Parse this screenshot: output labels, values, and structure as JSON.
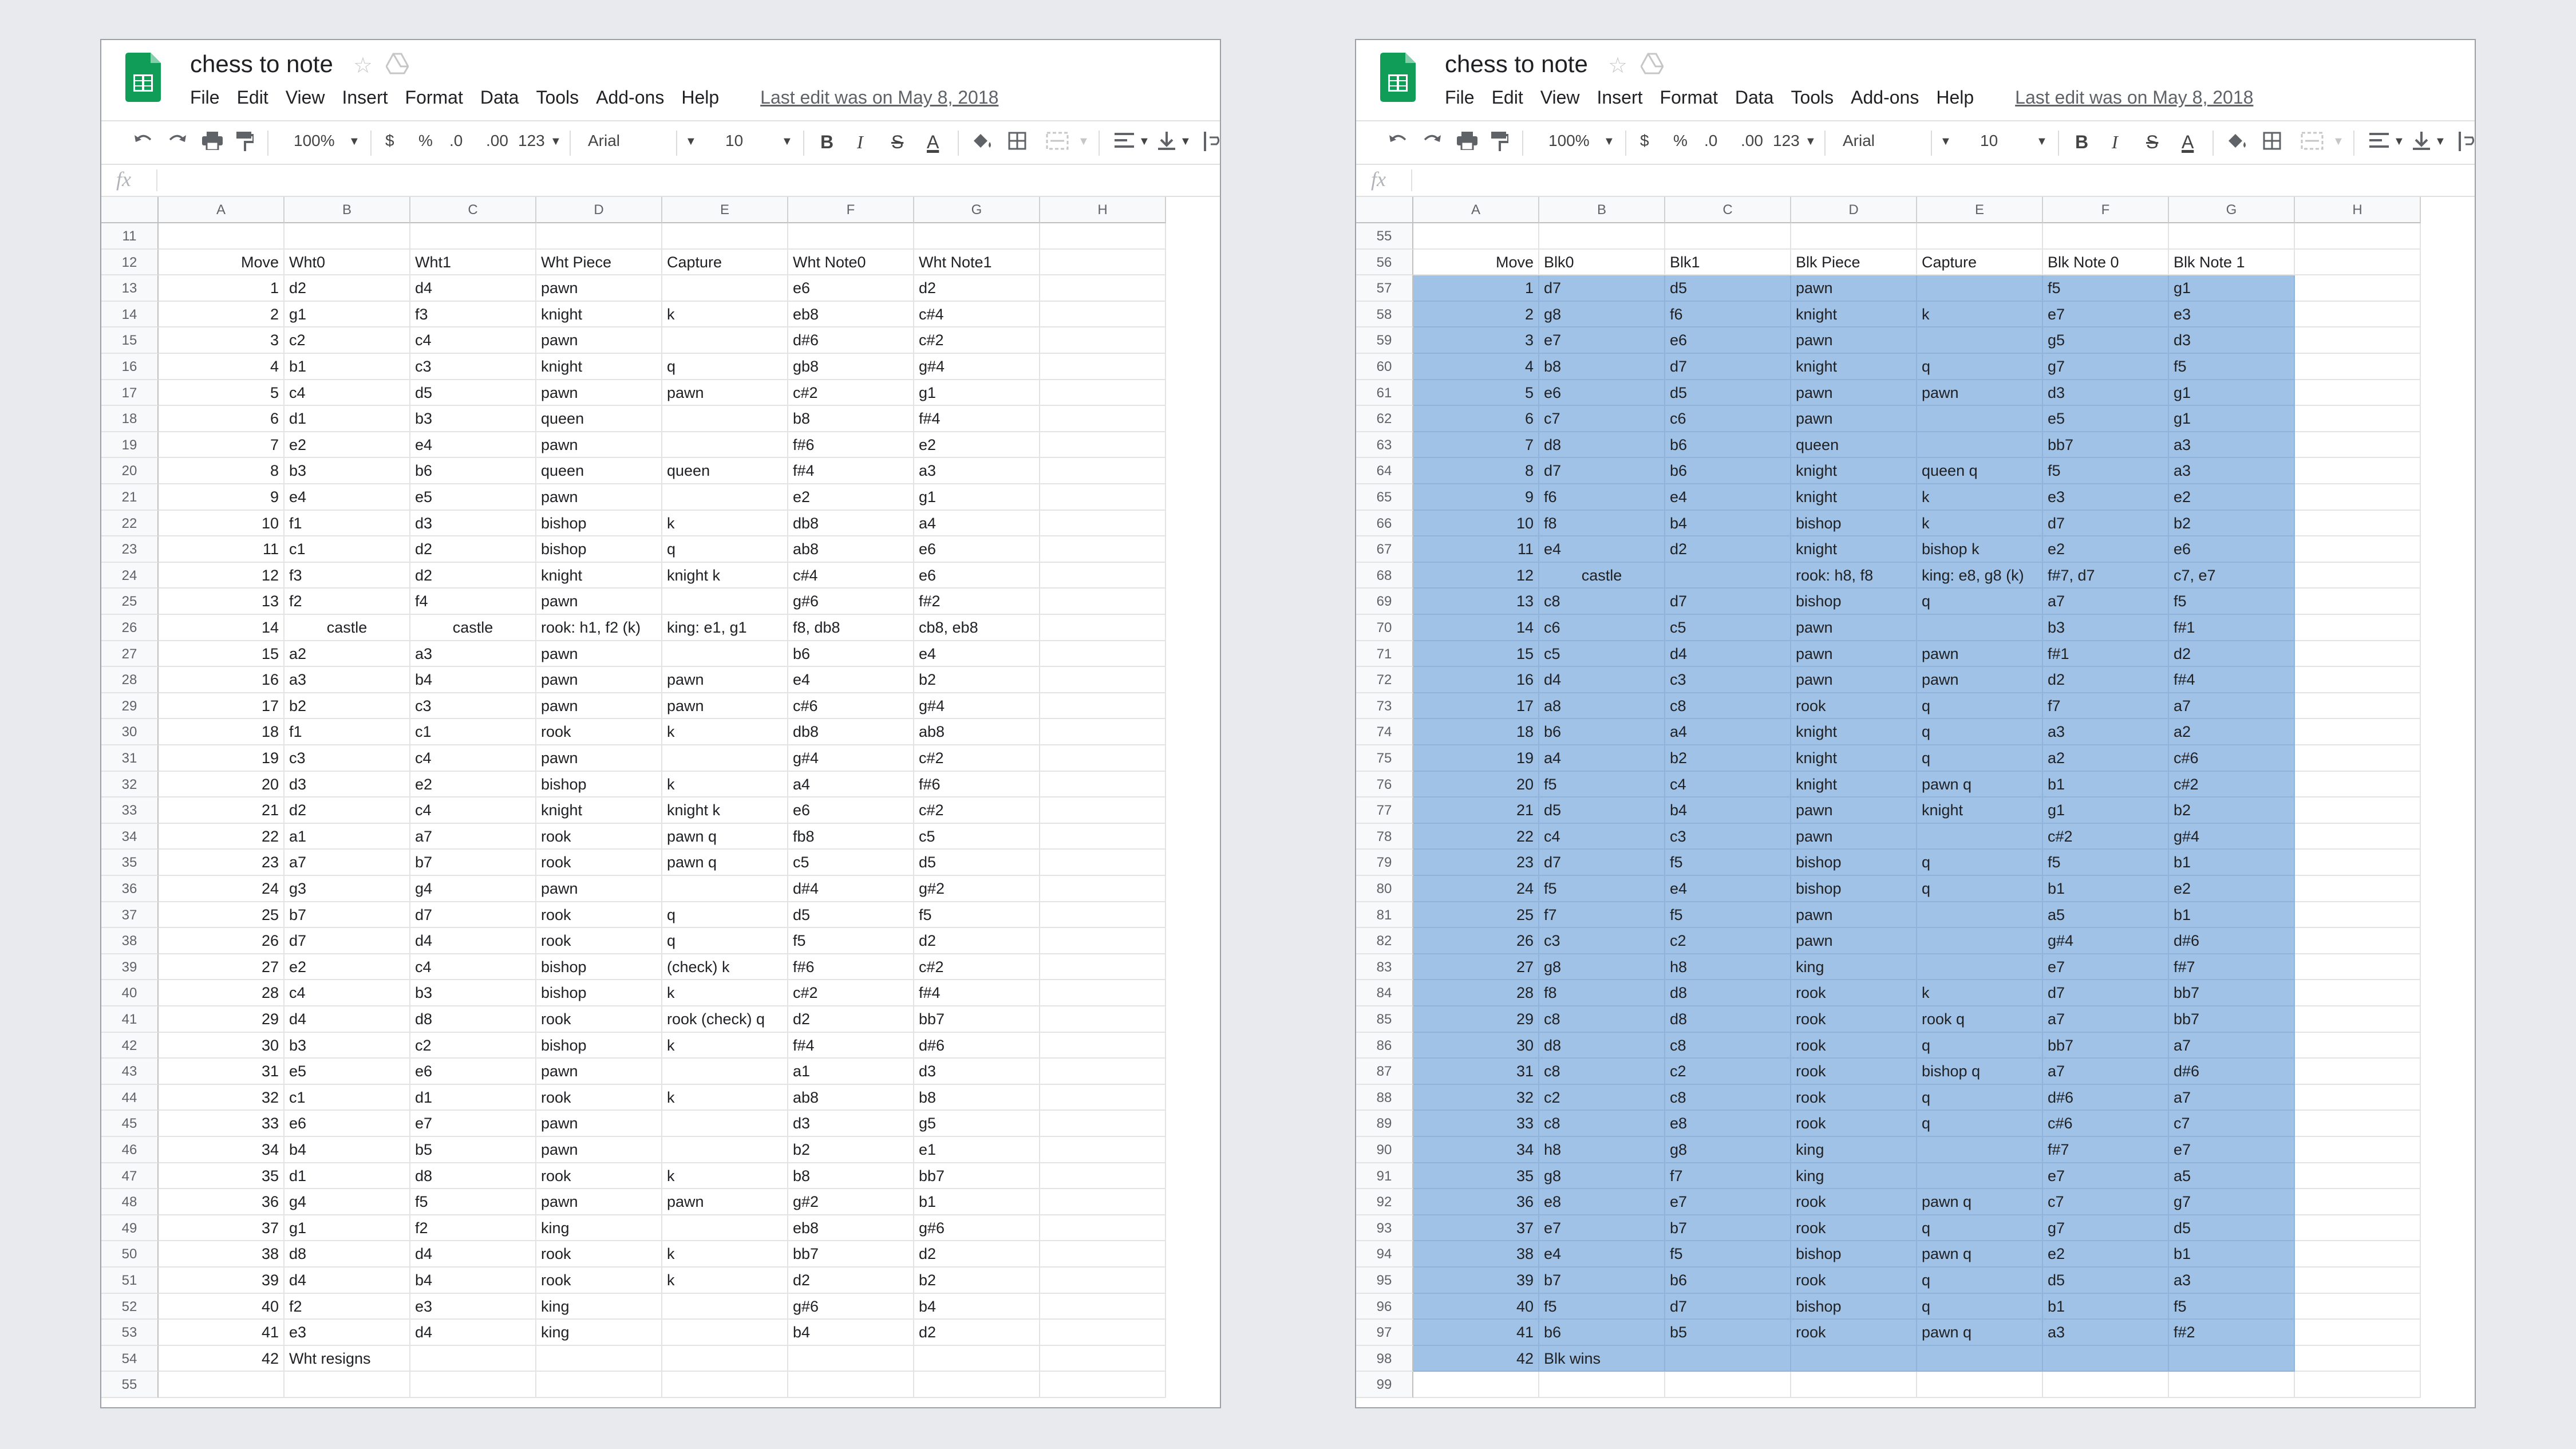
{
  "sheets": [
    {
      "title": "chess to note",
      "menu": [
        "File",
        "Edit",
        "View",
        "Insert",
        "Format",
        "Data",
        "Tools",
        "Add-ons",
        "Help"
      ],
      "last_edit": "Last edit was on May 8, 2018",
      "toolbar": {
        "zoom": "100%",
        "currency": "$",
        "percent": "%",
        "dec_less": ".0",
        "dec_more": ".00",
        "format_more": "123",
        "font": "Arial",
        "font_size": "10",
        "bold": "B",
        "italic": "I",
        "strike": "S",
        "text_color": "A"
      },
      "fx": "fx",
      "columns": [
        "A",
        "B",
        "C",
        "D",
        "E",
        "F",
        "G",
        "H"
      ],
      "selection_start": 0,
      "selection_end": 0,
      "rows": [
        {
          "n": "11",
          "c": [
            "",
            "",
            "",
            "",
            "",
            "",
            ""
          ]
        },
        {
          "n": "12",
          "c": [
            "Move",
            "Wht0",
            "Wht1",
            "Wht Piece",
            "Capture",
            "Wht Note0",
            "Wht Note1"
          ]
        },
        {
          "n": "13",
          "c": [
            "1",
            "d2",
            "d4",
            "pawn",
            "",
            "e6",
            "d2"
          ]
        },
        {
          "n": "14",
          "c": [
            "2",
            "g1",
            "f3",
            "knight",
            "k",
            "eb8",
            "c#4"
          ]
        },
        {
          "n": "15",
          "c": [
            "3",
            "c2",
            "c4",
            "pawn",
            "",
            "d#6",
            "c#2"
          ]
        },
        {
          "n": "16",
          "c": [
            "4",
            "b1",
            "c3",
            "knight",
            "q",
            "gb8",
            "g#4"
          ]
        },
        {
          "n": "17",
          "c": [
            "5",
            "c4",
            "d5",
            "pawn",
            "pawn",
            "c#2",
            "g1"
          ]
        },
        {
          "n": "18",
          "c": [
            "6",
            "d1",
            "b3",
            "queen",
            "",
            "b8",
            "f#4"
          ]
        },
        {
          "n": "19",
          "c": [
            "7",
            "e2",
            "e4",
            "pawn",
            "",
            "f#6",
            "e2"
          ]
        },
        {
          "n": "20",
          "c": [
            "8",
            "b3",
            "b6",
            "queen",
            "queen",
            "f#4",
            "a3"
          ]
        },
        {
          "n": "21",
          "c": [
            "9",
            "e4",
            "e5",
            "pawn",
            "",
            "e2",
            "g1"
          ]
        },
        {
          "n": "22",
          "c": [
            "10",
            "f1",
            "d3",
            "bishop",
            "k",
            "db8",
            "a4"
          ]
        },
        {
          "n": "23",
          "c": [
            "11",
            "c1",
            "d2",
            "bishop",
            "q",
            "ab8",
            "e6"
          ]
        },
        {
          "n": "24",
          "c": [
            "12",
            "f3",
            "d2",
            "knight",
            "knight k",
            "c#4",
            "e6"
          ]
        },
        {
          "n": "25",
          "c": [
            "13",
            "f2",
            "f4",
            "pawn",
            "",
            "g#6",
            "f#2"
          ]
        },
        {
          "n": "26",
          "c": [
            "14",
            "castle",
            "castle",
            "rook: h1, f2 (k)",
            "king: e1, g1",
            "f8, db8",
            "cb8, eb8"
          ],
          "castle": true
        },
        {
          "n": "27",
          "c": [
            "15",
            "a2",
            "a3",
            "pawn",
            "",
            "b6",
            "e4"
          ]
        },
        {
          "n": "28",
          "c": [
            "16",
            "a3",
            "b4",
            "pawn",
            "pawn",
            "e4",
            "b2"
          ]
        },
        {
          "n": "29",
          "c": [
            "17",
            "b2",
            "c3",
            "pawn",
            "pawn",
            "c#6",
            "g#4"
          ]
        },
        {
          "n": "30",
          "c": [
            "18",
            "f1",
            "c1",
            "rook",
            "k",
            "db8",
            "ab8"
          ]
        },
        {
          "n": "31",
          "c": [
            "19",
            "c3",
            "c4",
            "pawn",
            "",
            "g#4",
            "c#2"
          ]
        },
        {
          "n": "32",
          "c": [
            "20",
            "d3",
            "e2",
            "bishop",
            "k",
            "a4",
            "f#6"
          ]
        },
        {
          "n": "33",
          "c": [
            "21",
            "d2",
            "c4",
            "knight",
            "knight k",
            "e6",
            "c#2"
          ]
        },
        {
          "n": "34",
          "c": [
            "22",
            "a1",
            "a7",
            "rook",
            "pawn q",
            "fb8",
            "c5"
          ]
        },
        {
          "n": "35",
          "c": [
            "23",
            "a7",
            "b7",
            "rook",
            "pawn q",
            "c5",
            "d5"
          ]
        },
        {
          "n": "36",
          "c": [
            "24",
            "g3",
            "g4",
            "pawn",
            "",
            "d#4",
            "g#2"
          ]
        },
        {
          "n": "37",
          "c": [
            "25",
            "b7",
            "d7",
            "rook",
            "q",
            "d5",
            "f5"
          ]
        },
        {
          "n": "38",
          "c": [
            "26",
            "d7",
            "d4",
            "rook",
            "q",
            "f5",
            "d2"
          ]
        },
        {
          "n": "39",
          "c": [
            "27",
            "e2",
            "c4",
            "bishop",
            "(check) k",
            "f#6",
            "c#2"
          ]
        },
        {
          "n": "40",
          "c": [
            "28",
            "c4",
            "b3",
            "bishop",
            "k",
            "c#2",
            "f#4"
          ]
        },
        {
          "n": "41",
          "c": [
            "29",
            "d4",
            "d8",
            "rook",
            "rook (check) q",
            "d2",
            "bb7"
          ]
        },
        {
          "n": "42",
          "c": [
            "30",
            "b3",
            "c2",
            "bishop",
            "k",
            "f#4",
            "d#6"
          ]
        },
        {
          "n": "43",
          "c": [
            "31",
            "e5",
            "e6",
            "pawn",
            "",
            "a1",
            "d3"
          ]
        },
        {
          "n": "44",
          "c": [
            "32",
            "c1",
            "d1",
            "rook",
            "k",
            "ab8",
            "b8"
          ]
        },
        {
          "n": "45",
          "c": [
            "33",
            "e6",
            "e7",
            "pawn",
            "",
            "d3",
            "g5"
          ]
        },
        {
          "n": "46",
          "c": [
            "34",
            "b4",
            "b5",
            "pawn",
            "",
            "b2",
            "e1"
          ]
        },
        {
          "n": "47",
          "c": [
            "35",
            "d1",
            "d8",
            "rook",
            "k",
            "b8",
            "bb7"
          ]
        },
        {
          "n": "48",
          "c": [
            "36",
            "g4",
            "f5",
            "pawn",
            "pawn",
            "g#2",
            "b1"
          ]
        },
        {
          "n": "49",
          "c": [
            "37",
            "g1",
            "f2",
            "king",
            "",
            "eb8",
            "g#6"
          ]
        },
        {
          "n": "50",
          "c": [
            "38",
            "d8",
            "d4",
            "rook",
            "k",
            "bb7",
            "d2"
          ]
        },
        {
          "n": "51",
          "c": [
            "39",
            "d4",
            "b4",
            "rook",
            "k",
            "d2",
            "b2"
          ]
        },
        {
          "n": "52",
          "c": [
            "40",
            "f2",
            "e3",
            "king",
            "",
            "g#6",
            "b4"
          ]
        },
        {
          "n": "53",
          "c": [
            "41",
            "e3",
            "d4",
            "king",
            "",
            "b4",
            "d2"
          ]
        },
        {
          "n": "54",
          "c": [
            "42",
            "Wht resigns",
            "",
            "",
            "",
            "",
            ""
          ]
        },
        {
          "n": "55",
          "c": [
            "",
            "",
            "",
            "",
            "",
            "",
            ""
          ]
        }
      ]
    },
    {
      "title": "chess to note",
      "menu": [
        "File",
        "Edit",
        "View",
        "Insert",
        "Format",
        "Data",
        "Tools",
        "Add-ons",
        "Help"
      ],
      "last_edit": "Last edit was on May 8, 2018",
      "toolbar": {
        "zoom": "100%",
        "currency": "$",
        "percent": "%",
        "dec_less": ".0",
        "dec_more": ".00",
        "format_more": "123",
        "font": "Arial",
        "font_size": "10",
        "bold": "B",
        "italic": "I",
        "strike": "S",
        "text_color": "A"
      },
      "fx": "fx",
      "columns": [
        "A",
        "B",
        "C",
        "D",
        "E",
        "F",
        "G",
        "H"
      ],
      "selection_start": 2,
      "selection_end": 43,
      "rows": [
        {
          "n": "55",
          "c": [
            "",
            "",
            "",
            "",
            "",
            "",
            ""
          ]
        },
        {
          "n": "56",
          "c": [
            "Move",
            "Blk0",
            "Blk1",
            "Blk Piece",
            "Capture",
            "Blk Note 0",
            "Blk Note 1"
          ]
        },
        {
          "n": "57",
          "c": [
            "1",
            "d7",
            "d5",
            "pawn",
            "",
            "f5",
            "g1"
          ]
        },
        {
          "n": "58",
          "c": [
            "2",
            "g8",
            "f6",
            "knight",
            "k",
            "e7",
            "e3"
          ]
        },
        {
          "n": "59",
          "c": [
            "3",
            "e7",
            "e6",
            "pawn",
            "",
            "g5",
            "d3"
          ]
        },
        {
          "n": "60",
          "c": [
            "4",
            "b8",
            "d7",
            "knight",
            "q",
            "g7",
            "f5"
          ]
        },
        {
          "n": "61",
          "c": [
            "5",
            "e6",
            "d5",
            "pawn",
            "pawn",
            "d3",
            "g1"
          ]
        },
        {
          "n": "62",
          "c": [
            "6",
            "c7",
            "c6",
            "pawn",
            "",
            "e5",
            "g1"
          ]
        },
        {
          "n": "63",
          "c": [
            "7",
            "d8",
            "b6",
            "queen",
            "",
            "bb7",
            "a3"
          ]
        },
        {
          "n": "64",
          "c": [
            "8",
            "d7",
            "b6",
            "knight",
            "queen q",
            "f5",
            "a3"
          ]
        },
        {
          "n": "65",
          "c": [
            "9",
            "f6",
            "e4",
            "knight",
            "k",
            "e3",
            "e2"
          ]
        },
        {
          "n": "66",
          "c": [
            "10",
            "f8",
            "b4",
            "bishop",
            "k",
            "d7",
            "b2"
          ]
        },
        {
          "n": "67",
          "c": [
            "11",
            "e4",
            "d2",
            "knight",
            "bishop k",
            "e2",
            "e6"
          ]
        },
        {
          "n": "68",
          "c": [
            "12",
            "castle",
            "",
            "rook: h8, f8",
            "king: e8, g8 (k)",
            "f#7, d7",
            "c7, e7"
          ],
          "castle": true
        },
        {
          "n": "69",
          "c": [
            "13",
            "c8",
            "d7",
            "bishop",
            "q",
            "a7",
            "f5"
          ]
        },
        {
          "n": "70",
          "c": [
            "14",
            "c6",
            "c5",
            "pawn",
            "",
            "b3",
            "f#1"
          ]
        },
        {
          "n": "71",
          "c": [
            "15",
            "c5",
            "d4",
            "pawn",
            "pawn",
            "f#1",
            "d2"
          ]
        },
        {
          "n": "72",
          "c": [
            "16",
            "d4",
            "c3",
            "pawn",
            "pawn",
            "d2",
            "f#4"
          ]
        },
        {
          "n": "73",
          "c": [
            "17",
            "a8",
            "c8",
            "rook",
            "q",
            "f7",
            "a7"
          ]
        },
        {
          "n": "74",
          "c": [
            "18",
            "b6",
            "a4",
            "knight",
            "q",
            "a3",
            "a2"
          ]
        },
        {
          "n": "75",
          "c": [
            "19",
            "a4",
            "b2",
            "knight",
            "q",
            "a2",
            "c#6"
          ]
        },
        {
          "n": "76",
          "c": [
            "20",
            "f5",
            "c4",
            "knight",
            "pawn q",
            "b1",
            "c#2"
          ]
        },
        {
          "n": "77",
          "c": [
            "21",
            "d5",
            "b4",
            "pawn",
            "knight",
            "g1",
            "b2"
          ]
        },
        {
          "n": "78",
          "c": [
            "22",
            "c4",
            "c3",
            "pawn",
            "",
            "c#2",
            "g#4"
          ]
        },
        {
          "n": "79",
          "c": [
            "23",
            "d7",
            "f5",
            "bishop",
            "q",
            "f5",
            "b1"
          ]
        },
        {
          "n": "80",
          "c": [
            "24",
            "f5",
            "e4",
            "bishop",
            "q",
            "b1",
            "e2"
          ]
        },
        {
          "n": "81",
          "c": [
            "25",
            "f7",
            "f5",
            "pawn",
            "",
            "a5",
            "b1"
          ]
        },
        {
          "n": "82",
          "c": [
            "26",
            "c3",
            "c2",
            "pawn",
            "",
            "g#4",
            "d#6"
          ]
        },
        {
          "n": "83",
          "c": [
            "27",
            "g8",
            "h8",
            "king",
            "",
            "e7",
            "f#7"
          ]
        },
        {
          "n": "84",
          "c": [
            "28",
            "f8",
            "d8",
            "rook",
            "k",
            "d7",
            "bb7"
          ]
        },
        {
          "n": "85",
          "c": [
            "29",
            "c8",
            "d8",
            "rook",
            "rook q",
            "a7",
            "bb7"
          ]
        },
        {
          "n": "86",
          "c": [
            "30",
            "d8",
            "c8",
            "rook",
            "q",
            "bb7",
            "a7"
          ]
        },
        {
          "n": "87",
          "c": [
            "31",
            "c8",
            "c2",
            "rook",
            "bishop q",
            "a7",
            "d#6"
          ]
        },
        {
          "n": "88",
          "c": [
            "32",
            "c2",
            "c8",
            "rook",
            "q",
            "d#6",
            "a7"
          ]
        },
        {
          "n": "89",
          "c": [
            "33",
            "c8",
            "e8",
            "rook",
            "q",
            "c#6",
            "c7"
          ]
        },
        {
          "n": "90",
          "c": [
            "34",
            "h8",
            "g8",
            "king",
            "",
            "f#7",
            "e7"
          ]
        },
        {
          "n": "91",
          "c": [
            "35",
            "g8",
            "f7",
            "king",
            "",
            "e7",
            "a5"
          ]
        },
        {
          "n": "92",
          "c": [
            "36",
            "e8",
            "e7",
            "rook",
            "pawn q",
            "c7",
            "g7"
          ]
        },
        {
          "n": "93",
          "c": [
            "37",
            "e7",
            "b7",
            "rook",
            "q",
            "g7",
            "d5"
          ]
        },
        {
          "n": "94",
          "c": [
            "38",
            "e4",
            "f5",
            "bishop",
            "pawn q",
            "e2",
            "b1"
          ]
        },
        {
          "n": "95",
          "c": [
            "39",
            "b7",
            "b6",
            "rook",
            "q",
            "d5",
            "a3"
          ]
        },
        {
          "n": "96",
          "c": [
            "40",
            "f5",
            "d7",
            "bishop",
            "q",
            "b1",
            "f5"
          ]
        },
        {
          "n": "97",
          "c": [
            "41",
            "b6",
            "b5",
            "rook",
            "pawn q",
            "a3",
            "f#2"
          ]
        },
        {
          "n": "98",
          "c": [
            "42",
            "Blk wins",
            "",
            "",
            "",
            "",
            ""
          ]
        },
        {
          "n": "99",
          "c": [
            "",
            "",
            "",
            "",
            "",
            "",
            ""
          ]
        }
      ]
    }
  ]
}
